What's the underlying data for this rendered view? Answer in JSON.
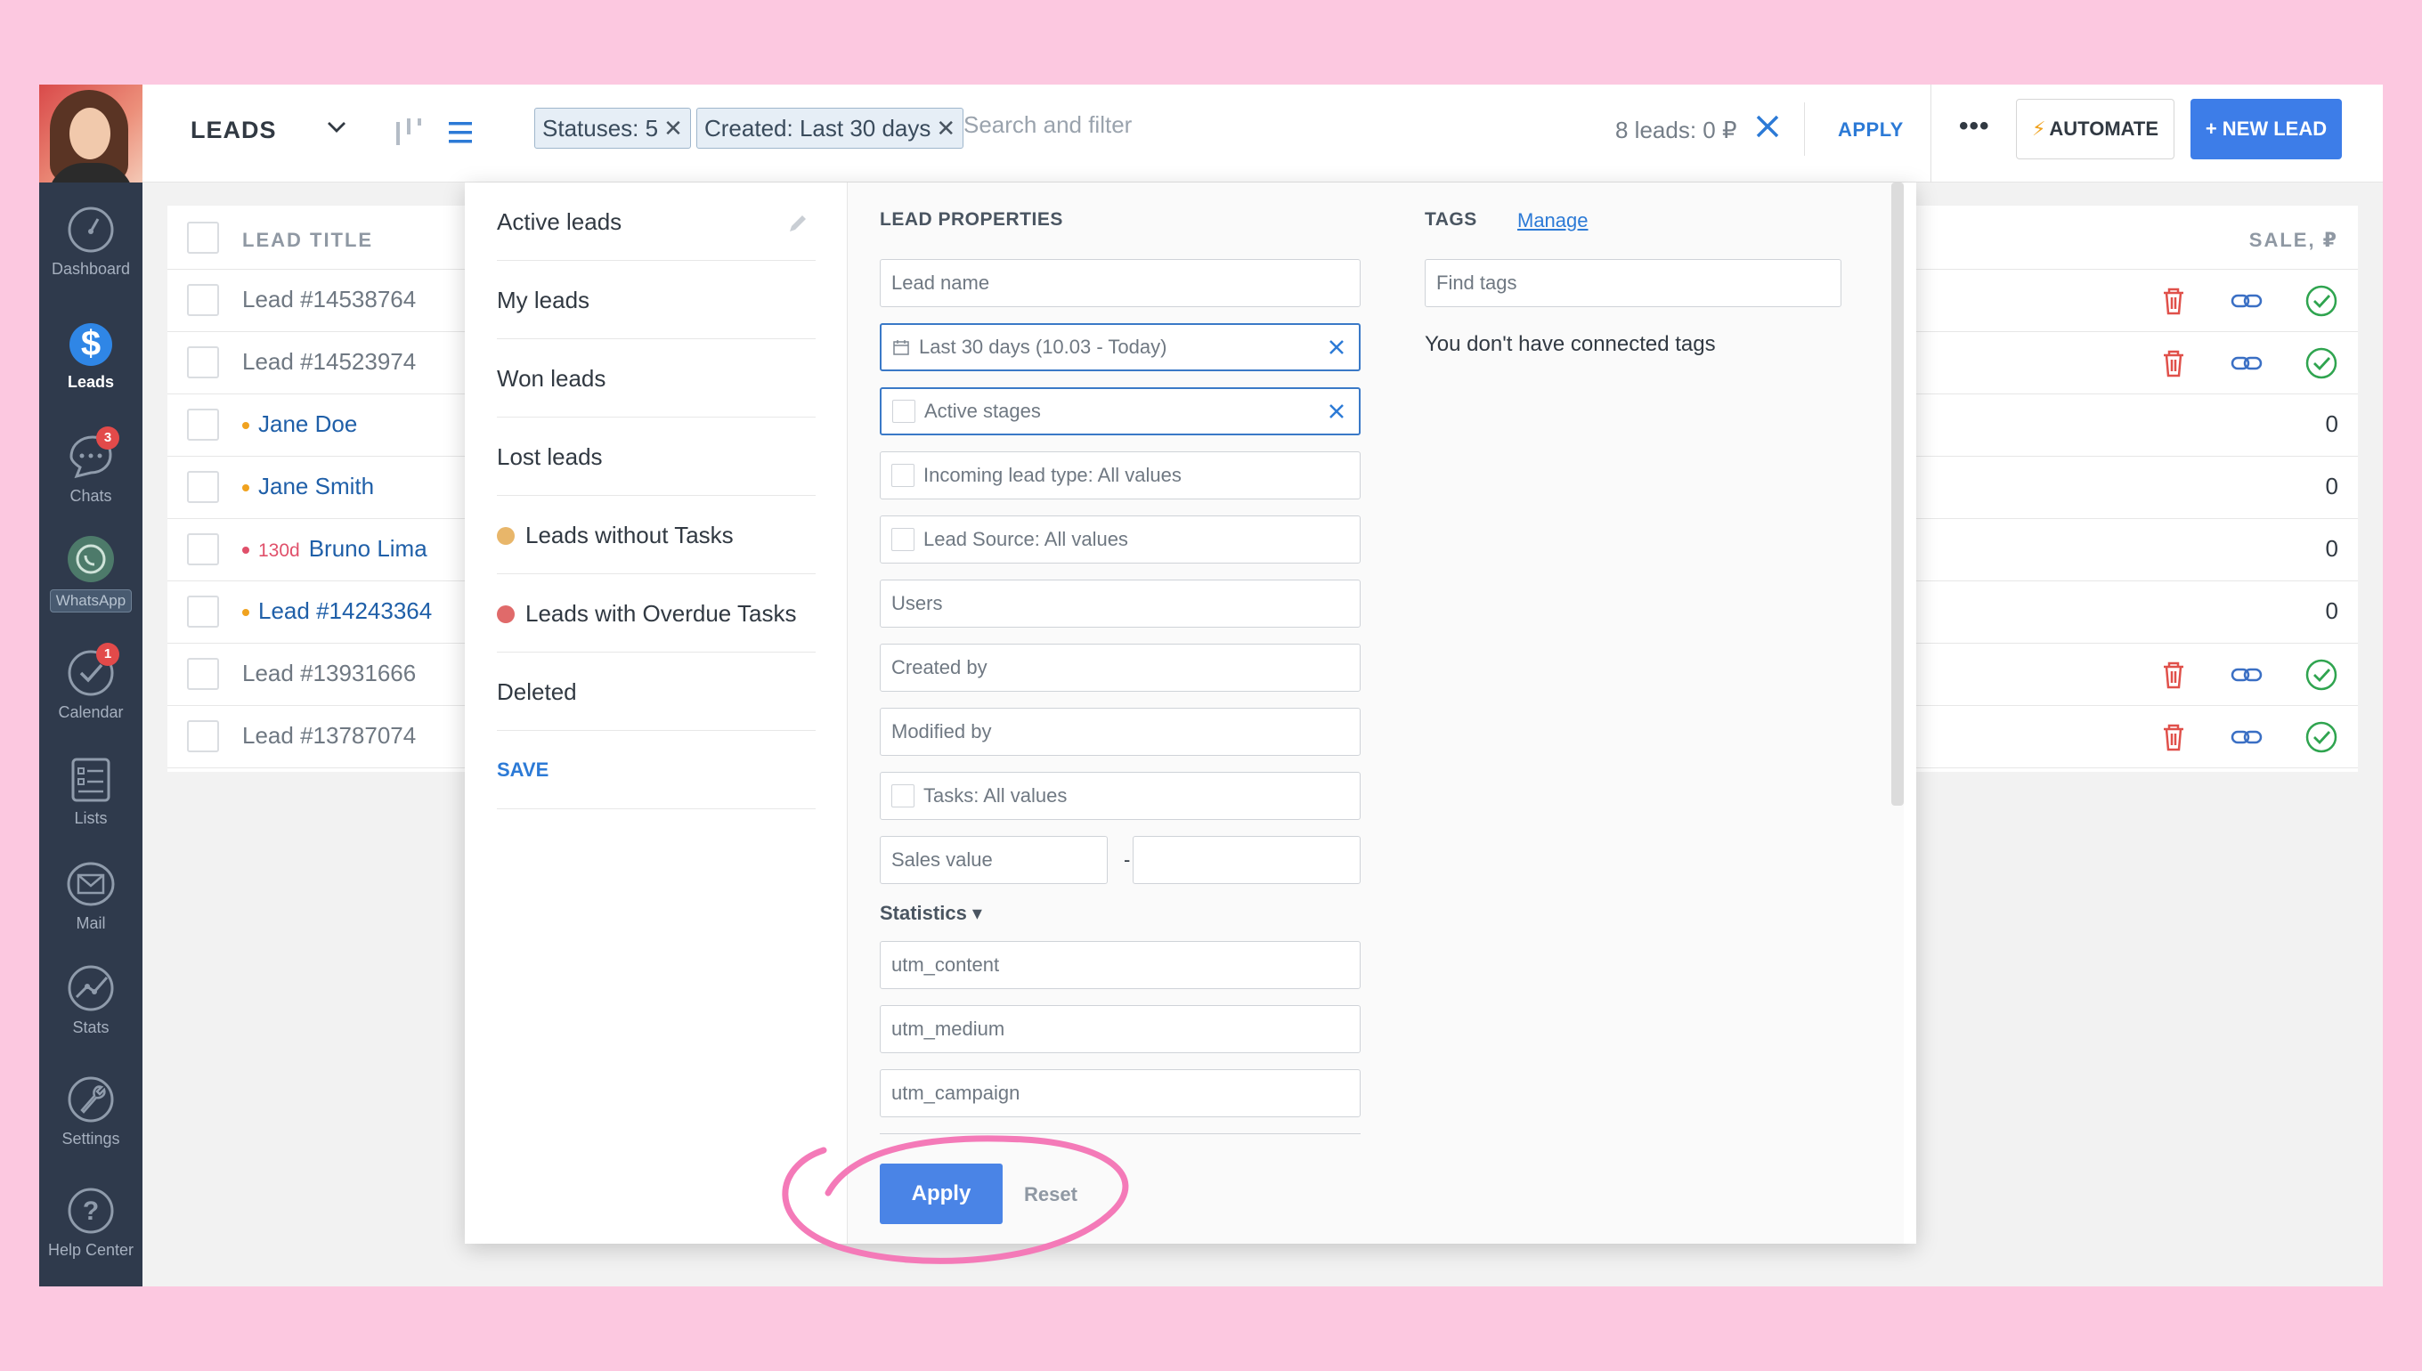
{
  "sidebar": {
    "items": [
      {
        "label": "Dashboard",
        "icon": "dashboard-icon"
      },
      {
        "label": "Leads",
        "icon": "leads-icon"
      },
      {
        "label": "Chats",
        "icon": "chats-icon",
        "badge": "3"
      },
      {
        "label": "WhatsApp",
        "icon": "whatsapp-icon"
      },
      {
        "label": "Calendar",
        "icon": "calendar-icon",
        "badge": "1"
      },
      {
        "label": "Lists",
        "icon": "lists-icon"
      },
      {
        "label": "Mail",
        "icon": "mail-icon"
      },
      {
        "label": "Stats",
        "icon": "stats-icon"
      },
      {
        "label": "Settings",
        "icon": "settings-icon"
      },
      {
        "label": "Help Center",
        "icon": "help-icon"
      }
    ]
  },
  "header": {
    "title": "LEADS",
    "chips": [
      "Statuses: 5",
      "Created: Last 30 days"
    ],
    "search_placeholder": "Search and filter",
    "leads_count": "8 leads: 0 ₽",
    "apply_label": "APPLY",
    "more_label": "•••",
    "automate_label": "AUTOMATE",
    "new_lead_label": "+ NEW LEAD"
  },
  "table": {
    "col_title": "LEAD TITLE",
    "col_sale": "SALE, ₽",
    "rows": [
      {
        "name": "Lead #14538764",
        "link": false,
        "actions": true,
        "value": ""
      },
      {
        "name": "Lead #14523974",
        "link": false,
        "actions": true,
        "value": ""
      },
      {
        "name": "Jane Doe",
        "link": true,
        "dot": "#f0a21f",
        "value": "0"
      },
      {
        "name": "Jane Smith",
        "link": true,
        "dot": "#f0a21f",
        "value": "0"
      },
      {
        "name": "Bruno Lima",
        "link": true,
        "dot": "#e0506a",
        "days": "130d",
        "value": "0"
      },
      {
        "name": "Lead #14243364",
        "link": true,
        "dot": "#f0a21f",
        "value": "0"
      },
      {
        "name": "Lead #13931666",
        "link": false,
        "actions": true,
        "value": ""
      },
      {
        "name": "Lead #13787074",
        "link": false,
        "actions": true,
        "value": ""
      }
    ]
  },
  "presets": {
    "items": [
      {
        "label": "Active leads"
      },
      {
        "label": "My leads"
      },
      {
        "label": "Won leads"
      },
      {
        "label": "Lost leads"
      },
      {
        "label": "Leads without Tasks",
        "dot": "#e8b66a"
      },
      {
        "label": "Leads with Overdue Tasks",
        "dot": "#e06a6a"
      },
      {
        "label": "Deleted"
      }
    ],
    "save_label": "SAVE"
  },
  "properties": {
    "title": "LEAD PROPERTIES",
    "lead_name_ph": "Lead name",
    "date_value": "Last 30 days (10.03 - Today)",
    "stages_value": "Active stages",
    "incoming_type": "Incoming lead type: All values",
    "lead_source": "Lead Source: All values",
    "users_ph": "Users",
    "created_by_ph": "Created by",
    "modified_by_ph": "Modified by",
    "tasks_value": "Tasks: All values",
    "sales_value_ph": "Sales value",
    "sales_to_ph": "",
    "range_dash": "-",
    "statistics_label": "Statistics ▾",
    "utm": [
      "utm_content",
      "utm_medium",
      "utm_campaign"
    ]
  },
  "tags": {
    "title": "TAGS",
    "manage_label": "Manage",
    "find_ph": "Find tags",
    "empty_text": "You don't have connected tags"
  },
  "actions": {
    "apply_label": "Apply",
    "reset_label": "Reset"
  },
  "colors": {
    "accent": "#3d7de8",
    "sidebar": "#2f3a4c",
    "highlight": "#f47ab8",
    "background": "#fcc8e0"
  }
}
